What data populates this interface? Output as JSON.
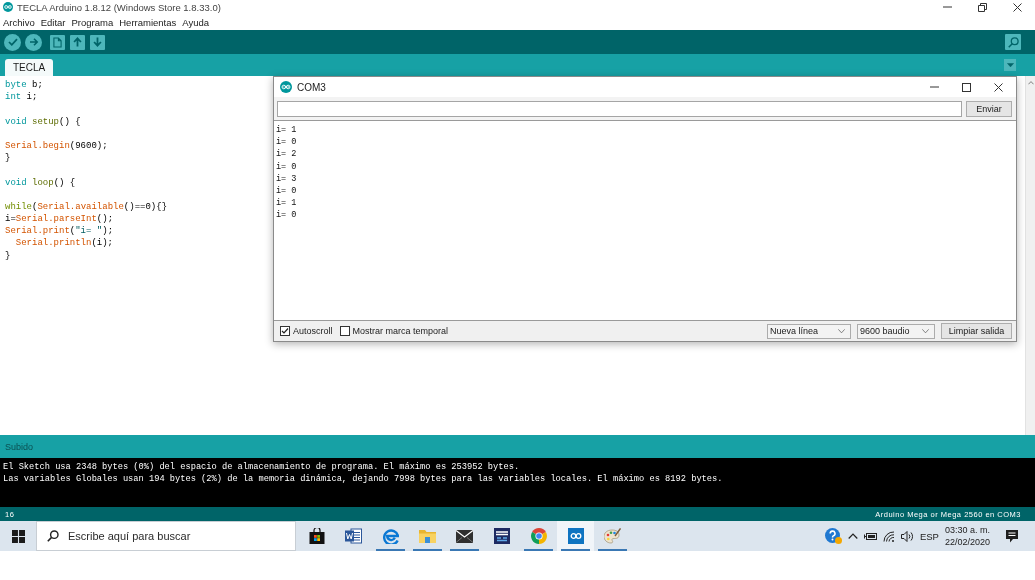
{
  "window": {
    "title": "TECLA Arduino 1.8.12 (Windows Store 1.8.33.0)"
  },
  "menu": [
    "Archivo",
    "Editar",
    "Programa",
    "Herramientas",
    "Ayuda"
  ],
  "tabs": [
    {
      "label": "TECLA",
      "selected": true
    }
  ],
  "editor": {
    "lines": [
      {
        "kind": "code",
        "tokens": [
          {
            "text": "byte",
            "kind": "type"
          },
          {
            "text": " b;",
            "kind": "plain"
          }
        ]
      },
      {
        "kind": "code",
        "tokens": [
          {
            "text": "int",
            "kind": "type"
          },
          {
            "text": " i;",
            "kind": "plain"
          }
        ]
      },
      {
        "kind": "blank"
      },
      {
        "kind": "code",
        "tokens": [
          {
            "text": "void ",
            "kind": "type"
          },
          {
            "text": "setup",
            "kind": "structure"
          },
          {
            "text": "() {",
            "kind": "plain"
          }
        ]
      },
      {
        "kind": "blank"
      },
      {
        "kind": "code",
        "tokens": [
          {
            "text": "Serial.begin",
            "kind": "function"
          },
          {
            "text": "(9600);",
            "kind": "plain"
          }
        ]
      },
      {
        "kind": "code",
        "tokens": [
          {
            "text": "}",
            "kind": "plain"
          }
        ]
      },
      {
        "kind": "blank"
      },
      {
        "kind": "code",
        "tokens": [
          {
            "text": "void ",
            "kind": "type"
          },
          {
            "text": "loop",
            "kind": "structure"
          },
          {
            "text": "() {",
            "kind": "plain"
          }
        ]
      },
      {
        "kind": "blank"
      },
      {
        "kind": "code",
        "tokens": [
          {
            "text": "while",
            "kind": "control"
          },
          {
            "text": "(",
            "kind": "plain"
          },
          {
            "text": "Serial.available",
            "kind": "function"
          },
          {
            "text": "()==0){}",
            "kind": "plain"
          }
        ]
      },
      {
        "kind": "code",
        "tokens": [
          {
            "text": "i=",
            "kind": "plain"
          },
          {
            "text": "Serial.parseInt",
            "kind": "function"
          },
          {
            "text": "();",
            "kind": "plain"
          }
        ]
      },
      {
        "kind": "code",
        "tokens": [
          {
            "text": "Serial.print",
            "kind": "function"
          },
          {
            "text": "(",
            "kind": "plain"
          },
          {
            "text": "\"i= \"",
            "kind": "string"
          },
          {
            "text": ");",
            "kind": "plain"
          }
        ]
      },
      {
        "kind": "code",
        "tokens": [
          {
            "text": "  Serial.println",
            "kind": "function"
          },
          {
            "text": "(i);",
            "kind": "plain"
          }
        ]
      },
      {
        "kind": "code",
        "tokens": [
          {
            "text": "}",
            "kind": "plain"
          }
        ]
      }
    ]
  },
  "serial_monitor": {
    "title": "COM3",
    "send_button": "Enviar",
    "output": [
      "i= 1",
      "i= 0",
      "i= 2",
      "i= 0",
      "i= 3",
      "i= 0",
      "i= 1",
      "i= 0"
    ],
    "autoscroll": {
      "label": "Autoscroll",
      "checked": true
    },
    "timestamp": {
      "label": "Mostrar marca temporal",
      "checked": false
    },
    "line_ending": "Nueva línea",
    "baud_rate": "9600 baudio",
    "clear_button": "Limpiar salida"
  },
  "status": {
    "message": "Subido",
    "console": [
      "El Sketch usa 2348 bytes (0%) del espacio de almacenamiento de programa. El máximo es 253952 bytes.",
      "Las variables Globales usan 194 bytes (2%) de la memoria dinámica, dejando 7998 bytes para las variables locales. El máximo es 8192 bytes."
    ],
    "line_number": "16",
    "board": "Arduino Mega or Mega 2560 en COM3"
  },
  "taskbar": {
    "search": {
      "placeholder": "Escribe aquí para buscar"
    },
    "apps": [
      {
        "kind": "store",
        "running": false,
        "selected": false
      },
      {
        "kind": "word",
        "running": false,
        "selected": false
      },
      {
        "kind": "edge",
        "running": true,
        "selected": false
      },
      {
        "kind": "explorer",
        "running": true,
        "selected": false
      },
      {
        "kind": "mail",
        "running": true,
        "selected": false
      },
      {
        "kind": "devcpp",
        "running": false,
        "selected": false
      },
      {
        "kind": "chrome",
        "running": true,
        "selected": false
      },
      {
        "kind": "arduino",
        "running": true,
        "selected": true
      },
      {
        "kind": "paint",
        "running": true,
        "selected": false
      }
    ],
    "language": "ESP",
    "time": "03:30 a. m.",
    "date": "22/02/2020"
  }
}
